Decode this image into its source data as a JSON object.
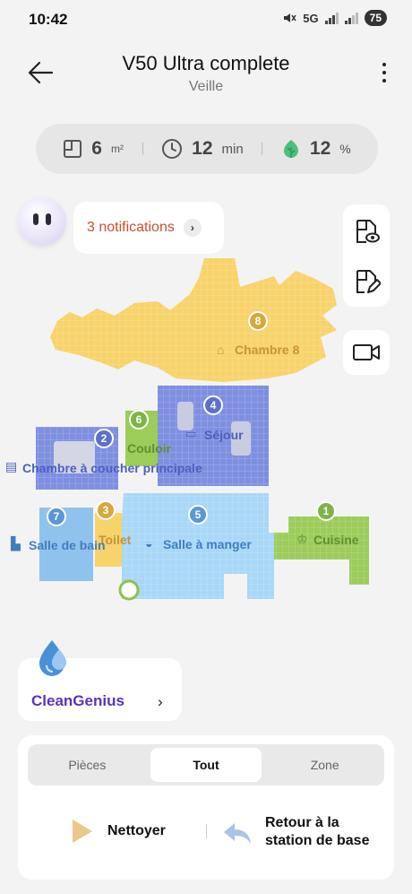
{
  "status_bar": {
    "time": "10:42",
    "network": "5G",
    "battery": "75"
  },
  "header": {
    "title": "V50 Ultra complete",
    "subtitle": "Veille"
  },
  "stats": {
    "area": {
      "value": "6",
      "unit": "m²"
    },
    "time": {
      "value": "12",
      "unit": "min"
    },
    "battery": {
      "value": "12",
      "unit": "%"
    }
  },
  "notifications": {
    "label": "3 notifications"
  },
  "map": {
    "rooms": [
      {
        "number": "8",
        "name": "Chambre 8",
        "color": "#f7d36b"
      },
      {
        "number": "4",
        "name": "Séjour",
        "color": "#7f8fe0"
      },
      {
        "number": "6",
        "name": "Couloir",
        "color": "#9ccc5a"
      },
      {
        "number": "2",
        "name": "Chambre à coucher principale",
        "color": "#7f8fe0"
      },
      {
        "number": "3",
        "name": "Toilet",
        "color": "#f7d36b"
      },
      {
        "number": "7",
        "name": "Salle de bain",
        "color": "#8fc3ee"
      },
      {
        "number": "5",
        "name": "Salle à manger",
        "color": "#a9d7f7"
      },
      {
        "number": "1",
        "name": "Cuisine",
        "color": "#9ccc5a"
      }
    ]
  },
  "clean_genius": {
    "label": "CleanGenius"
  },
  "mode_tabs": [
    {
      "label": "Pièces",
      "active": false
    },
    {
      "label": "Tout",
      "active": true
    },
    {
      "label": "Zone",
      "active": false
    }
  ],
  "actions": {
    "clean": "Nettoyer",
    "return_line1": "Retour à la",
    "return_line2": "station de base"
  }
}
